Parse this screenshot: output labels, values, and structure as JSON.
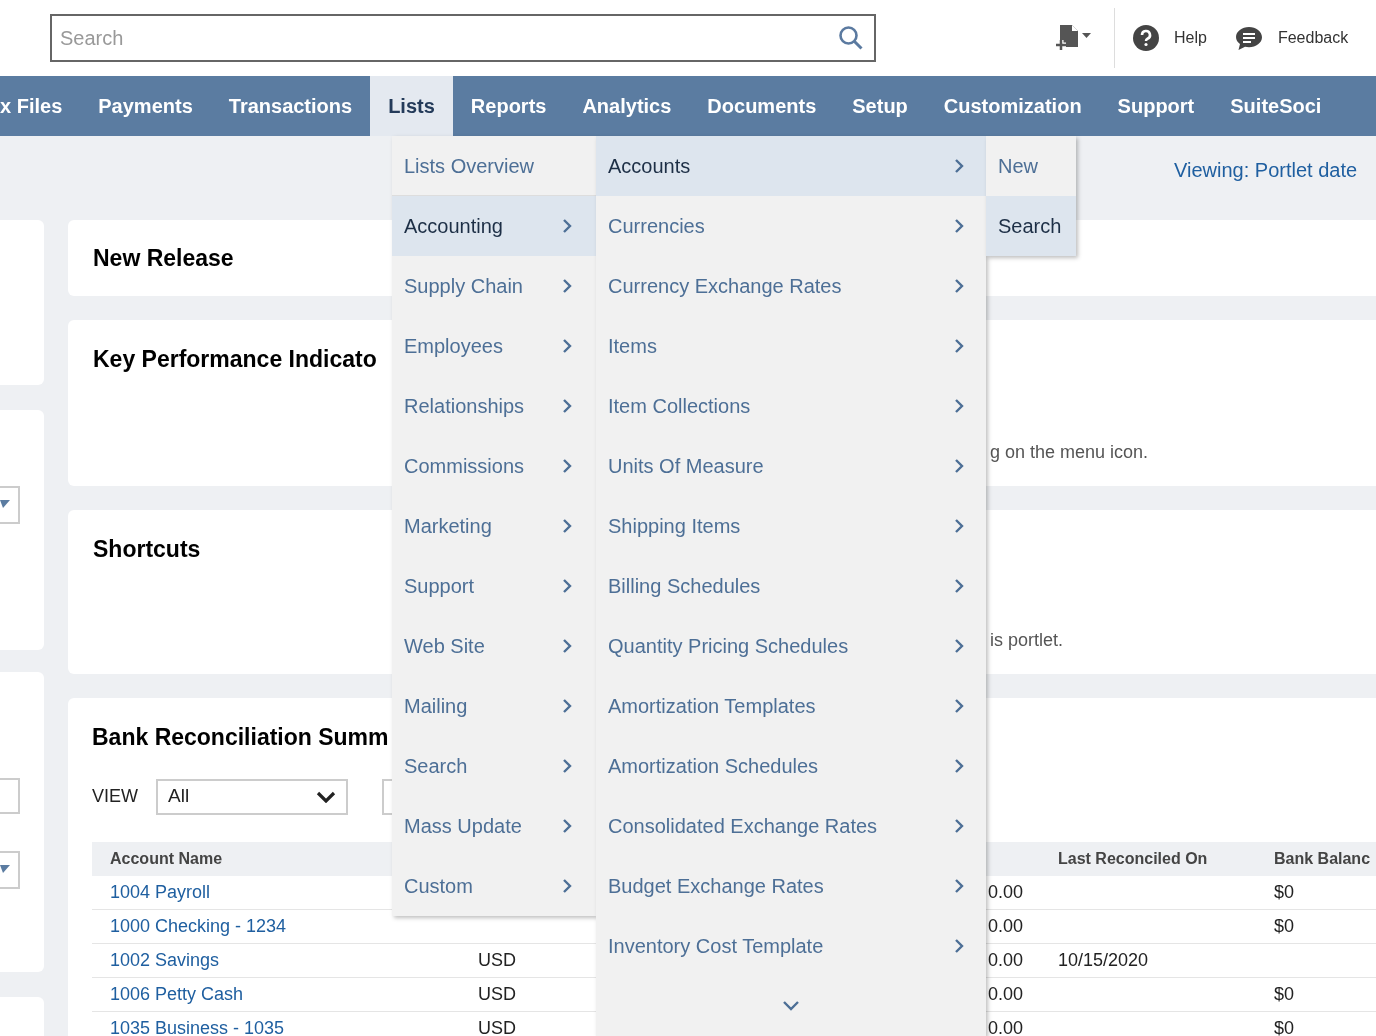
{
  "header": {
    "search": {
      "placeholder": "Search"
    },
    "links": [
      {
        "label": "Help",
        "kind": "help"
      },
      {
        "label": "Feedback",
        "kind": "feedback"
      }
    ]
  },
  "nav": [
    {
      "label": "x Files",
      "selected": false
    },
    {
      "label": "Payments",
      "selected": false
    },
    {
      "label": "Transactions",
      "selected": false
    },
    {
      "label": "Lists",
      "selected": true
    },
    {
      "label": "Reports",
      "selected": false
    },
    {
      "label": "Analytics",
      "selected": false
    },
    {
      "label": "Documents",
      "selected": false
    },
    {
      "label": "Setup",
      "selected": false
    },
    {
      "label": "Customization",
      "selected": false
    },
    {
      "label": "Support",
      "selected": false
    },
    {
      "label": "SuiteSoci",
      "selected": false
    }
  ],
  "viewing": "Viewing: Portlet date",
  "portlets": [
    {
      "title": "New Release"
    },
    {
      "title": "Key Performance Indicato",
      "note": "g on the menu icon."
    },
    {
      "title": "Shortcuts",
      "note": "is portlet."
    }
  ],
  "bank_reconciliation": {
    "title": "Bank Reconciliation Summ",
    "view_label": "VIEW",
    "view_value": "All",
    "columns": [
      "Account Name",
      "",
      "",
      "Last Reconciled On",
      "Bank Balanc"
    ],
    "rows": [
      {
        "cells": [
          "1004 Payroll",
          "",
          "0.00",
          "",
          "$0"
        ]
      },
      {
        "cells": [
          "1000 Checking - 1234",
          "",
          "0.00",
          "",
          "$0"
        ]
      },
      {
        "cells": [
          "1002 Savings",
          "USD",
          "0.00",
          "10/15/2020",
          ""
        ]
      },
      {
        "cells": [
          "1006 Petty Cash",
          "USD",
          "0.00",
          "",
          "$0"
        ]
      },
      {
        "cells": [
          "1035 Business - 1035",
          "USD",
          "0.00",
          "",
          "$0"
        ]
      }
    ]
  },
  "menus": [
    {
      "items": [
        {
          "label": "Lists Overview",
          "selected": false,
          "has_submenu": false
        },
        {
          "label": "Accounting",
          "selected": true,
          "has_submenu": true
        },
        {
          "label": "Supply Chain",
          "selected": false,
          "has_submenu": true
        },
        {
          "label": "Employees",
          "selected": false,
          "has_submenu": true
        },
        {
          "label": "Relationships",
          "selected": false,
          "has_submenu": true
        },
        {
          "label": "Commissions",
          "selected": false,
          "has_submenu": true
        },
        {
          "label": "Marketing",
          "selected": false,
          "has_submenu": true
        },
        {
          "label": "Support",
          "selected": false,
          "has_submenu": true
        },
        {
          "label": "Web Site",
          "selected": false,
          "has_submenu": true
        },
        {
          "label": "Mailing",
          "selected": false,
          "has_submenu": true
        },
        {
          "label": "Search",
          "selected": false,
          "has_submenu": true
        },
        {
          "label": "Mass Update",
          "selected": false,
          "has_submenu": true
        },
        {
          "label": "Custom",
          "selected": false,
          "has_submenu": true
        }
      ]
    },
    {
      "items": [
        {
          "label": "Accounts",
          "selected": true,
          "has_submenu": true
        },
        {
          "label": "Currencies",
          "selected": false,
          "has_submenu": true
        },
        {
          "label": "Currency Exchange Rates",
          "selected": false,
          "has_submenu": true
        },
        {
          "label": "Items",
          "selected": false,
          "has_submenu": true
        },
        {
          "label": "Item Collections",
          "selected": false,
          "has_submenu": true
        },
        {
          "label": "Units Of Measure",
          "selected": false,
          "has_submenu": true
        },
        {
          "label": "Shipping Items",
          "selected": false,
          "has_submenu": true
        },
        {
          "label": "Billing Schedules",
          "selected": false,
          "has_submenu": true
        },
        {
          "label": "Quantity Pricing Schedules",
          "selected": false,
          "has_submenu": true
        },
        {
          "label": "Amortization Templates",
          "selected": false,
          "has_submenu": true
        },
        {
          "label": "Amortization Schedules",
          "selected": false,
          "has_submenu": true
        },
        {
          "label": "Consolidated Exchange Rates",
          "selected": false,
          "has_submenu": true
        },
        {
          "label": "Budget Exchange Rates",
          "selected": false,
          "has_submenu": true
        },
        {
          "label": "Inventory Cost Template",
          "selected": false,
          "has_submenu": true
        }
      ],
      "more_below": true
    },
    {
      "items": [
        {
          "label": "New",
          "selected": false,
          "has_submenu": false
        },
        {
          "label": "Search",
          "selected": true,
          "has_submenu": false
        }
      ]
    }
  ]
}
